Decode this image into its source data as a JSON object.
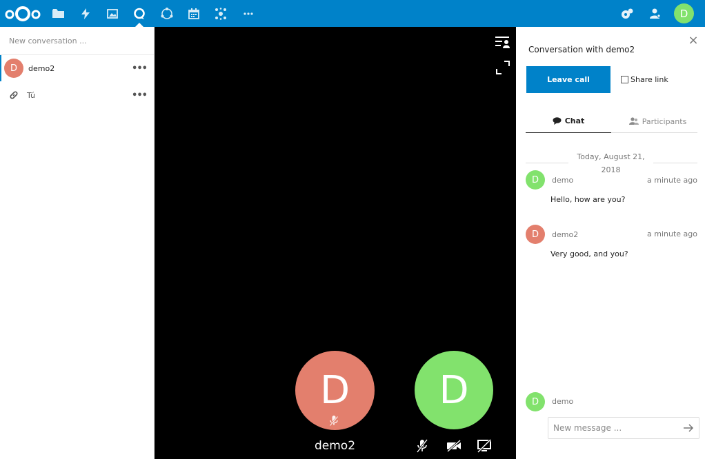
{
  "colors": {
    "brand": "#0082c9",
    "stage": "#000000",
    "avatar_demo": "#82e26d",
    "avatar_demo2": "#e37f6d"
  },
  "header": {
    "apps": [
      {
        "name": "files",
        "icon": "folder-icon"
      },
      {
        "name": "activity",
        "icon": "lightning-icon"
      },
      {
        "name": "gallery",
        "icon": "image-icon"
      },
      {
        "name": "talk",
        "icon": "talk-icon",
        "active": true
      },
      {
        "name": "circles",
        "icon": "circles-icon"
      },
      {
        "name": "calendar",
        "icon": "calendar-icon"
      },
      {
        "name": "social",
        "icon": "network-icon"
      },
      {
        "name": "more",
        "icon": "more-icon"
      }
    ],
    "right_icons": [
      "notifications-icon",
      "contacts-icon"
    ],
    "user_initial": "D"
  },
  "nav": {
    "search_placeholder": "New conversation ...",
    "conversations": [
      {
        "initial": "D",
        "name": "demo2",
        "active": true
      },
      {
        "icon": "link-icon",
        "name": "Tú"
      }
    ],
    "more_label": "•••"
  },
  "stage": {
    "participants": [
      {
        "initial": "D",
        "name": "demo2",
        "color": "#e37f6d",
        "muted": true
      },
      {
        "initial": "D",
        "name": "",
        "color": "#82e26d"
      }
    ],
    "controls": [
      "mute-icon",
      "video-off-icon",
      "screen-share-off-icon"
    ]
  },
  "sidebar": {
    "close_label": "×",
    "title": "Conversation with demo2",
    "leave_label": "Leave call",
    "share_label": "Share link",
    "tabs": [
      {
        "label": "Chat",
        "active": true
      },
      {
        "label": "Participants",
        "active": false
      }
    ],
    "date_separator": "Today, August 21, 2018",
    "messages": [
      {
        "initial": "D",
        "author": "demo",
        "time": "a minute ago",
        "text": "Hello, how are you?",
        "color": "#82e26d"
      },
      {
        "initial": "D",
        "author": "demo2",
        "time": "a minute ago",
        "text": "Very good, and you?",
        "color": "#e37f6d"
      }
    ],
    "composer": {
      "initial": "D",
      "author": "demo",
      "placeholder": "New message ..."
    }
  }
}
